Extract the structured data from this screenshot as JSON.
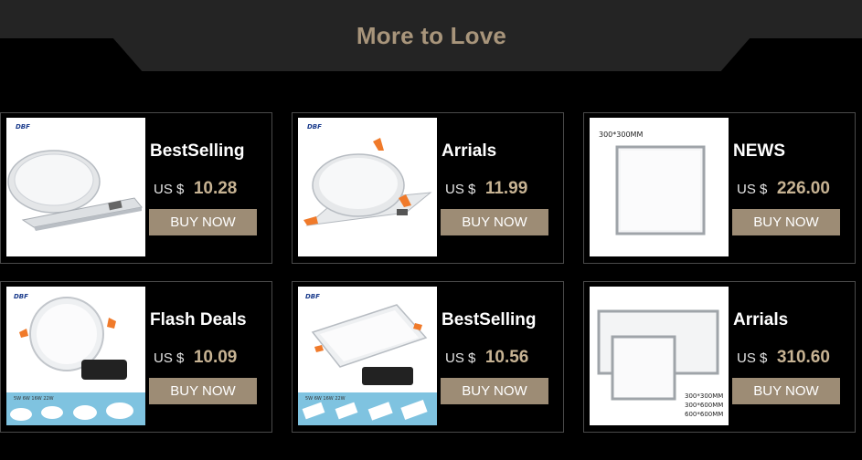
{
  "section_title": "More to Love",
  "products": [
    {
      "tag": "BestSelling",
      "currency": "US $",
      "price": "10.28",
      "button": "BUY NOW",
      "image_caption": "",
      "brand": "DBF"
    },
    {
      "tag": "Arrials",
      "currency": "US $",
      "price": "11.99",
      "button": "BUY NOW",
      "image_caption": "",
      "brand": "DBF"
    },
    {
      "tag": "NEWS",
      "currency": "US $",
      "price": "226.00",
      "button": "BUY NOW",
      "image_caption": "300*300MM",
      "brand": ""
    },
    {
      "tag": "Flash Deals",
      "currency": "US $",
      "price": "10.09",
      "button": "BUY NOW",
      "image_caption": "5W 6W 16W 22W",
      "brand": "DBF"
    },
    {
      "tag": "BestSelling",
      "currency": "US $",
      "price": "10.56",
      "button": "BUY NOW",
      "image_caption": "5W 6W 16W 22W",
      "brand": "DBF"
    },
    {
      "tag": "Arrials",
      "currency": "US $",
      "price": "310.60",
      "button": "BUY NOW",
      "image_caption": [
        "300*300MM",
        "300*600MM",
        "600*600MM"
      ],
      "brand": ""
    }
  ],
  "colors": {
    "page_background": "#000000",
    "banner_background": "#242424",
    "title_color": "#a8957b",
    "price_color": "#c7b393",
    "button_color": "#9d8c75",
    "card_border": "#4a4a4a"
  }
}
